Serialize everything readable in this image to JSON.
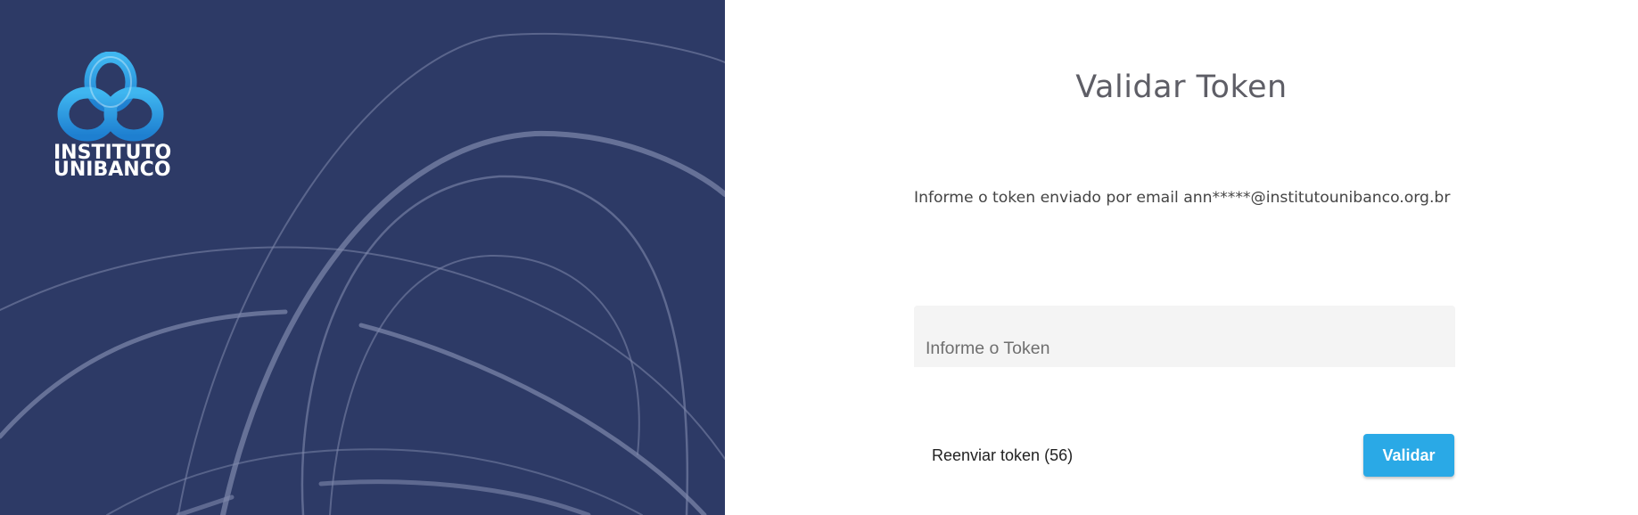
{
  "brand": {
    "logo_line1": "INSTITUTO",
    "logo_line2": "UNIBANCO",
    "panel_color": "#2d3a66",
    "accent_color": "#2aa9e6"
  },
  "page": {
    "title": "Validar Token",
    "instruction": "Informe o token enviado por email ann*****@institutounibanco.org.br"
  },
  "form": {
    "token_placeholder": "Informe o Token",
    "token_value": ""
  },
  "actions": {
    "resend_label": "Reenviar token (56)",
    "validate_label": "Validar"
  }
}
